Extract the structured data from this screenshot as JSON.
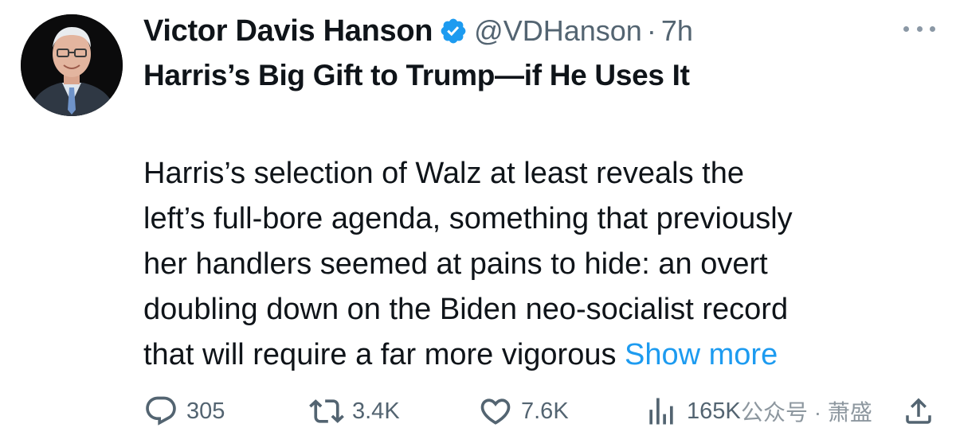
{
  "author": {
    "name": "Victor Davis Hanson",
    "handle": "@VDHanson",
    "separator": "·",
    "time": "7h"
  },
  "tweet": {
    "headline": "Harris’s Big Gift to Trump—if He Uses It",
    "body_lines": [
      "Harris’s selection of Walz at least reveals the",
      "left’s full-bore agenda, something that previously",
      "her handlers seemed at pains to hide: an overt",
      "doubling down on the Biden neo-socialist record",
      "that will require a far more vigorous "
    ],
    "show_more_label": "Show more"
  },
  "actions": {
    "replies": "305",
    "reposts": "3.4K",
    "likes": "7.6K",
    "views": "165K"
  },
  "watermark": "公众号 · 萧盛",
  "icons": {
    "verified": "verified-badge-icon",
    "more": "more-options-icon",
    "reply": "reply-icon",
    "repost": "repost-icon",
    "like": "heart-icon",
    "views": "views-icon",
    "share": "share-icon"
  },
  "colors": {
    "text": "#0f1419",
    "secondary": "#536471",
    "link": "#1d9bf0",
    "verified": "#1d9bf0"
  }
}
